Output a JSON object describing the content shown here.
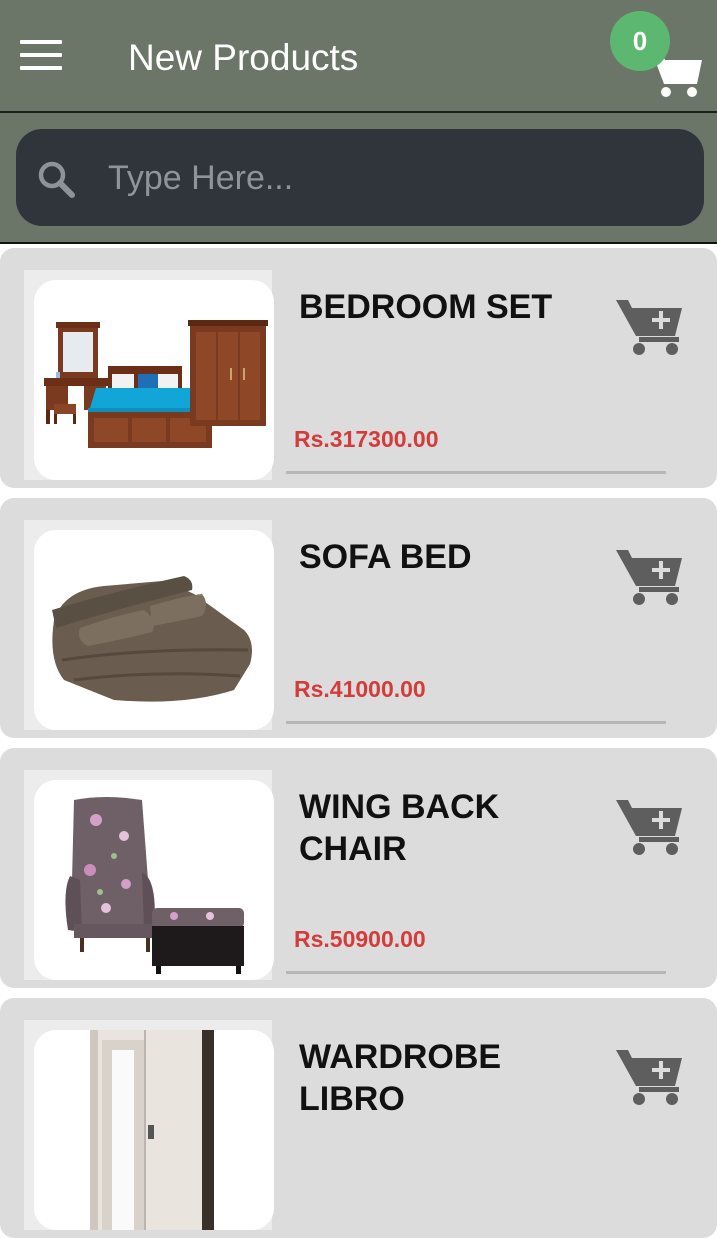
{
  "header": {
    "title": "New Products",
    "cart_count": "0"
  },
  "search": {
    "placeholder": "Type Here..."
  },
  "products": [
    {
      "name": "BEDROOM SET",
      "price": "Rs.317300.00"
    },
    {
      "name": "SOFA BED",
      "price": "Rs.41000.00"
    },
    {
      "name": "WING BACK CHAIR",
      "price": "Rs.50900.00"
    },
    {
      "name": "WARDROBE LIBRO",
      "price": ""
    }
  ],
  "icons": {
    "menu": "hamburger-menu-icon",
    "cart": "shopping-cart-icon",
    "search": "search-icon",
    "add_to_cart": "add-shopping-cart-icon"
  },
  "colors": {
    "appbar": "#6c7668",
    "search_box": "#30343b",
    "badge": "#5cb870",
    "card": "#dcdcdc",
    "price": "#d43c3c",
    "icon_gray": "#5e5e5e"
  }
}
